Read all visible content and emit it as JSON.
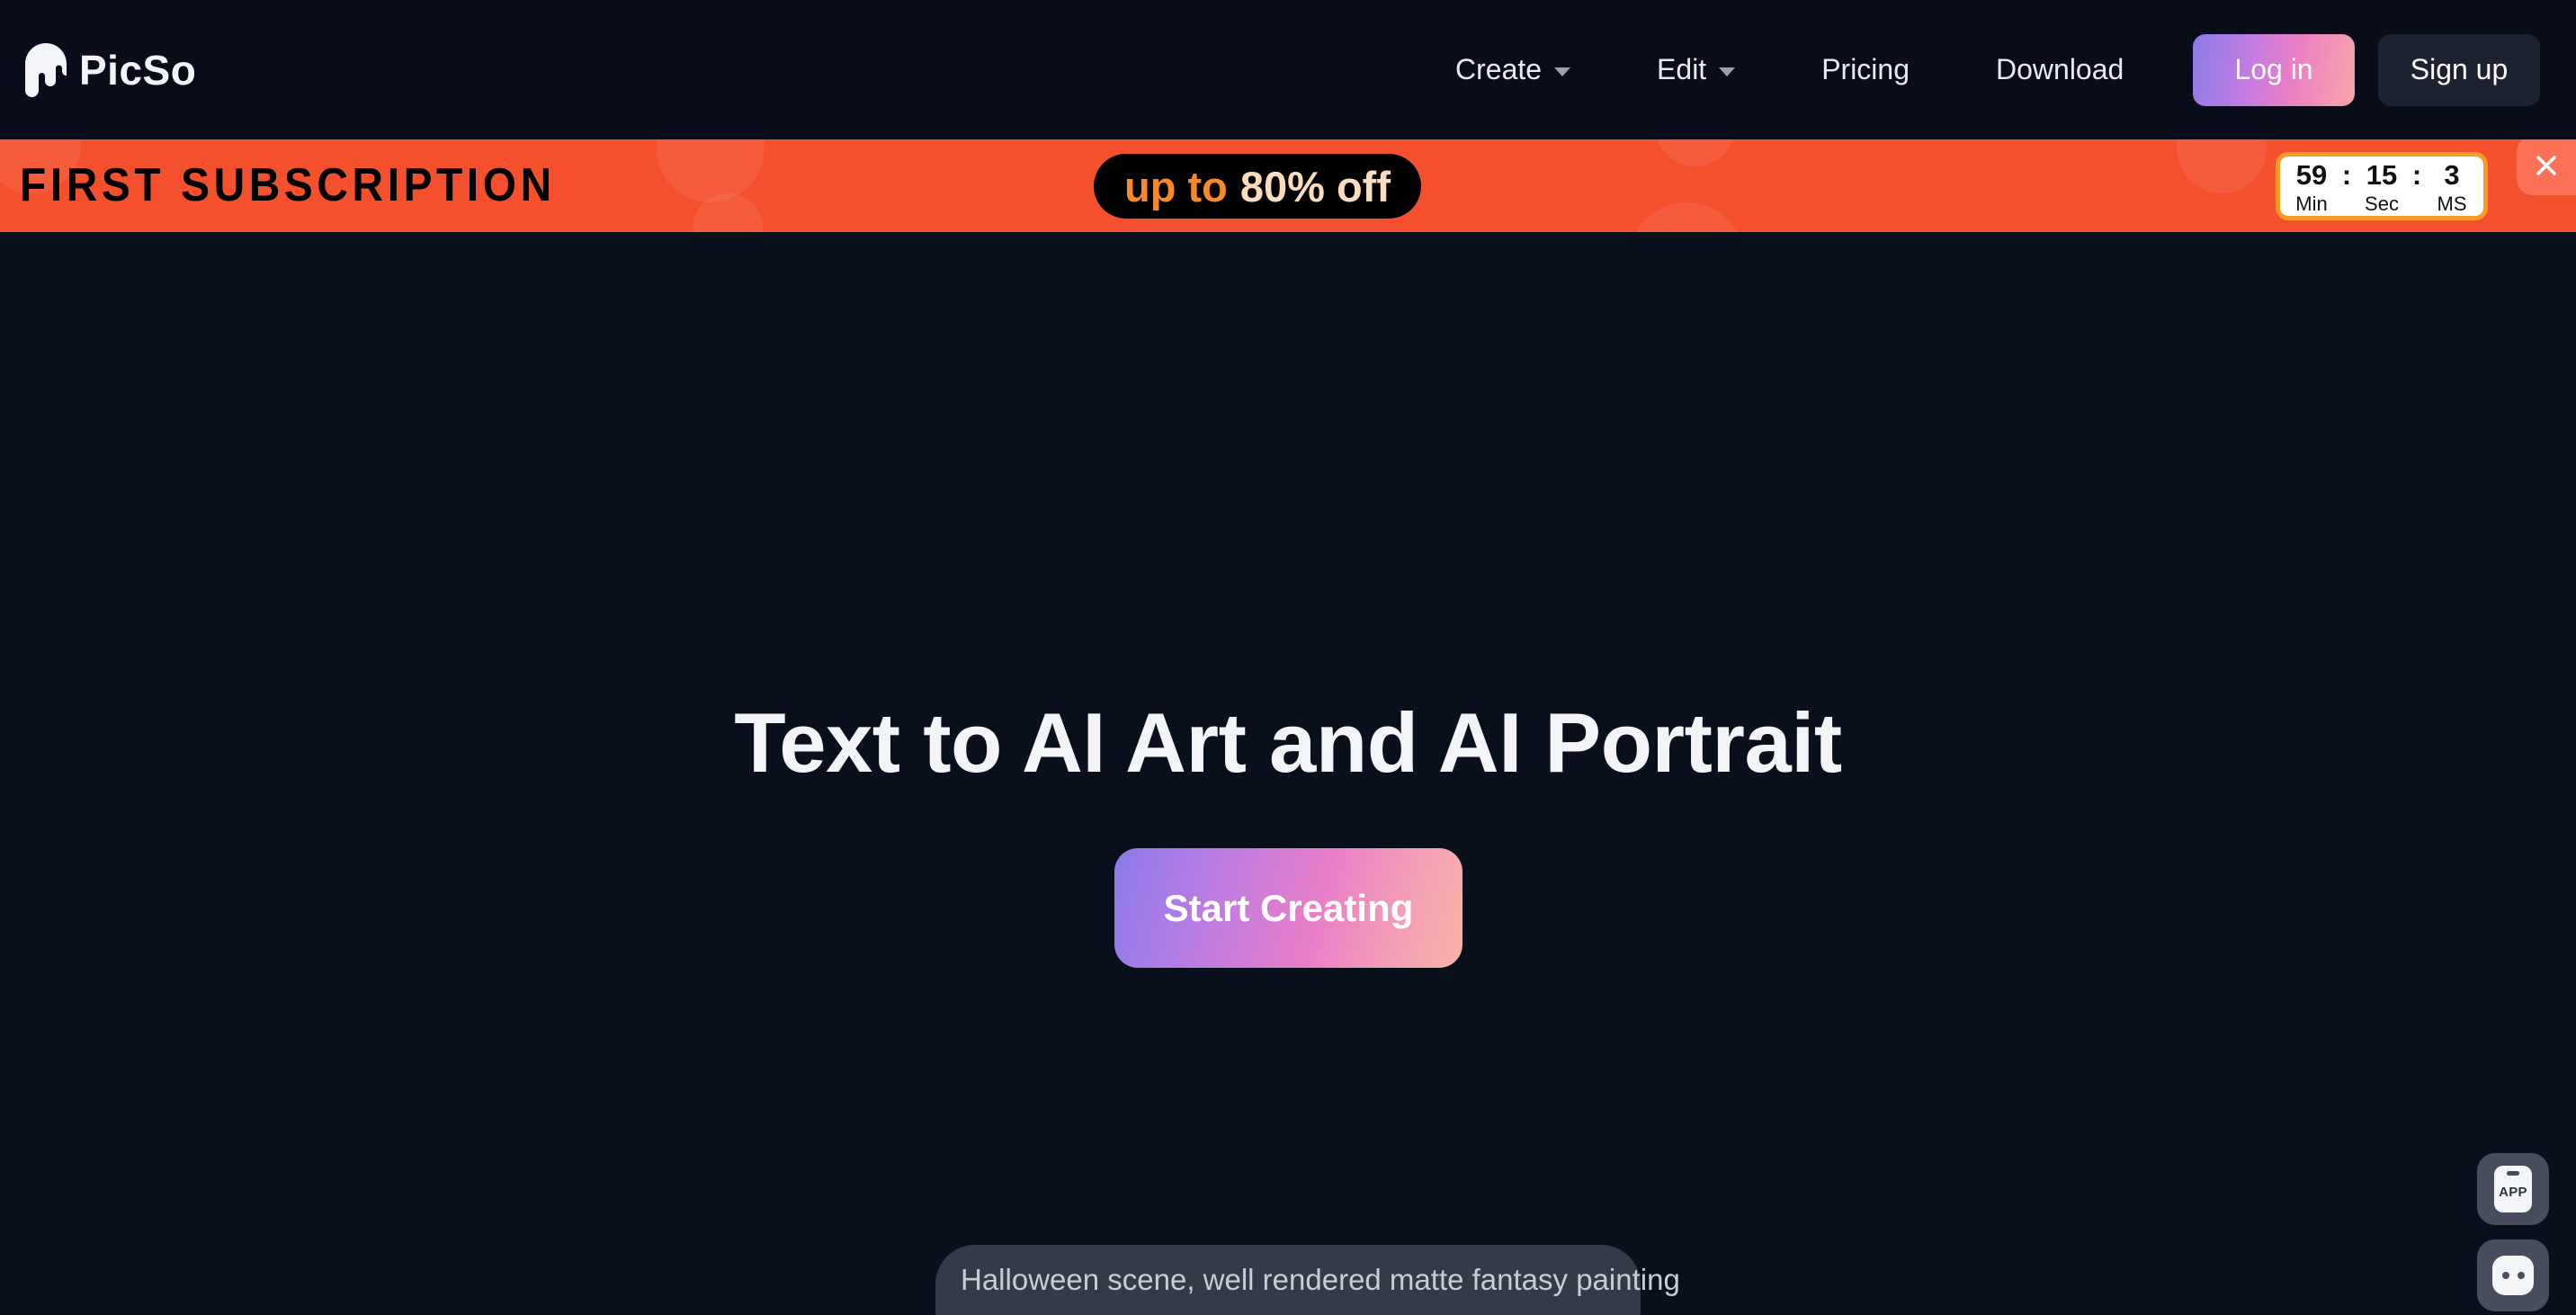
{
  "brand": {
    "name": "PicSo",
    "logo_icon": "paint-drip-icon"
  },
  "nav": {
    "items": [
      {
        "label": "Create",
        "has_dropdown": true,
        "icon": "chevron-down-icon"
      },
      {
        "label": "Edit",
        "has_dropdown": true,
        "icon": "chevron-down-icon"
      },
      {
        "label": "Pricing",
        "has_dropdown": false,
        "icon": ""
      },
      {
        "label": "Download",
        "has_dropdown": false,
        "icon": ""
      }
    ]
  },
  "auth": {
    "login_label": "Log in",
    "signup_label": "Sign up",
    "login_gradient_start": "#8b7ae8",
    "login_gradient_end": "#f6a6a8",
    "signup_bg": "#1d2230"
  },
  "promo": {
    "title": "FIRST SUBSCRIPTION",
    "pill_prefix": "up to",
    "pill_discount": "80% off",
    "background_color": "#f4502e",
    "pill_bg": "#000000",
    "pill_prefix_color": "#f7892a",
    "pill_discount_color": "#fbdcc0",
    "close_icon": "close-icon",
    "timer": {
      "minutes": "59",
      "seconds": "15",
      "milliseconds": "3",
      "separator": ":",
      "minutes_label": "Min",
      "seconds_label": "Sec",
      "ms_label": "MS",
      "border_color": "#fb9928"
    }
  },
  "hero": {
    "title": "Text to AI Art and AI Portrait",
    "cta_label": "Start Creating",
    "cta_gradient_start": "#8a7ae9",
    "cta_gradient_end": "#f9b3a6",
    "background_color": "#0a0f1c"
  },
  "prompt_chip": {
    "text": "Halloween scene, well rendered matte fantasy painting",
    "background_color": "#343a47"
  },
  "floating_buttons": [
    {
      "name": "app-download-button",
      "icon": "mobile-app-icon",
      "label": "APP"
    },
    {
      "name": "chat-support-button",
      "icon": "chat-bubble-icon",
      "label": ""
    }
  ]
}
